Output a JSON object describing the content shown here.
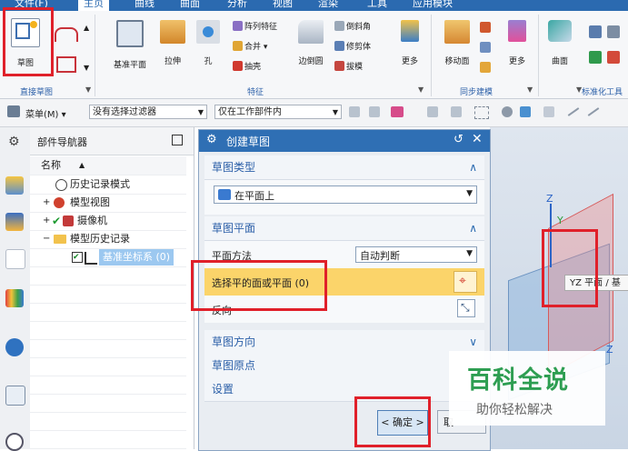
{
  "menu": {
    "tabs": [
      "文件(F)",
      "主页",
      "曲线",
      "曲面",
      "分析",
      "视图",
      "渲染",
      "工具",
      "应用模块"
    ],
    "active_tab": "主页"
  },
  "ribbon": {
    "sketch": "草图",
    "direct_sketch_group": "直接草图",
    "feature_group": "特征",
    "sync_group": "同步建模",
    "std_group": "标准化工具",
    "datum_plane": "基准平面",
    "extrude": "拉伸",
    "hole": "孔",
    "pattern_feature": "阵列特征",
    "unite": "合并",
    "shell": "抽壳",
    "edge_blend": "边倒圆",
    "chamfer": "倒斜角",
    "trim_body": "修剪体",
    "draft": "拔模",
    "more1": "更多",
    "move_face": "移动面",
    "more2": "更多",
    "surface": "曲面"
  },
  "toolbar": {
    "menu_label": "菜单(M)",
    "filter_value": "没有选择过滤器",
    "scope_value": "仅在工作部件内"
  },
  "navigator": {
    "title": "部件导航器",
    "column_name": "名称",
    "items": [
      "历史记录模式",
      "模型视图",
      "摄像机",
      "模型历史记录",
      "基准坐标系 (0)"
    ]
  },
  "dialog": {
    "title": "创建草图",
    "sketch_type_header": "草图类型",
    "sketch_type_value": "在平面上",
    "sketch_plane_header": "草图平面",
    "plane_method_label": "平面方法",
    "plane_method_value": "自动判断",
    "select_plane_label": "选择平的面或平面 (0)",
    "reverse_label": "反向",
    "sketch_direction_header": "草图方向",
    "sketch_origin_header": "草图原点",
    "settings_header": "设置",
    "ok_button": "< 确定 >",
    "cancel_partial": "取"
  },
  "viewport": {
    "plane_label": "YZ 平面 / 基",
    "axis_z": "Z",
    "axis_y": "Y",
    "axis_z2": "Z"
  },
  "watermark": {
    "title": "百科全说",
    "subtitle": "助你轻松解决"
  },
  "colors": {
    "accent": "#2b6ab0",
    "highlight_row": "#fbd46a",
    "annotation_red": "#e0202a",
    "watermark_green": "#2e9e52"
  }
}
